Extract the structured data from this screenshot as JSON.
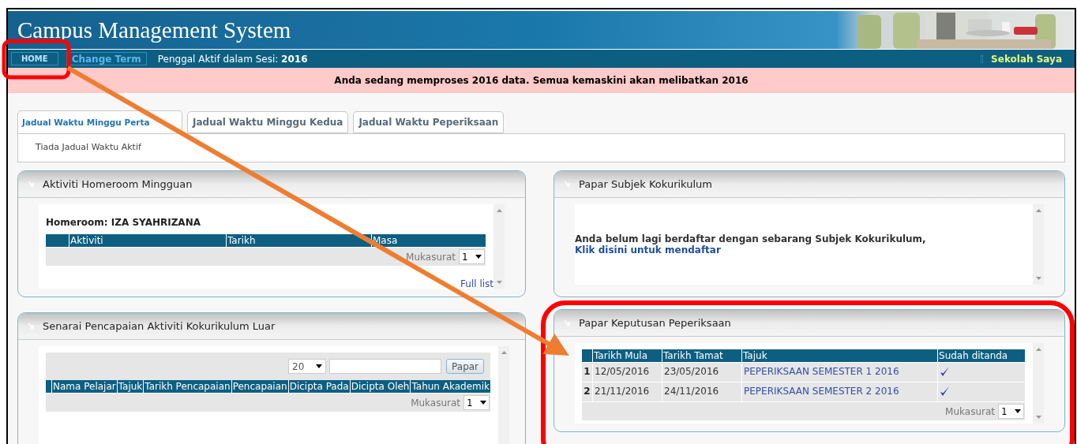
{
  "header": {
    "title": "Campus Management System"
  },
  "nav": {
    "home_button": "HOME",
    "change_term_button": "Change Term",
    "session_label": "Penggal Aktif dalam Sesi:",
    "session_value": "2016",
    "right_link": "Sekolah Saya"
  },
  "notice": "Anda sedang memproses 2016 data. Semua kemaskini akan melibatkan 2016",
  "tabs": [
    {
      "label": "Jadual Waktu Minggu Perta",
      "selected": true
    },
    {
      "label": "Jadual Waktu Minggu Kedua",
      "selected": false
    },
    {
      "label": "Jadual Waktu Peperiksaan",
      "selected": false
    }
  ],
  "tab_content": "Tiada Jadual Waktu Aktif",
  "homeroom_panel": {
    "title": "Aktiviti Homeroom Mingguan",
    "heading": "Homeroom: IZA SYAHRIZANA",
    "columns": [
      "Aktiviti",
      "Tarikh",
      "Masa"
    ],
    "pager_label": "Mukasurat",
    "page": "1",
    "full_list": "Full list"
  },
  "kokurikulum_panel": {
    "title": "Papar Subjek Kokurikulum",
    "message": "Anda belum lagi berdaftar dengan sebarang Subjek Kokurikulum,",
    "link": "Klik disini untuk mendaftar"
  },
  "achievement_panel": {
    "title": "Senarai Pencapaian Aktiviti Kokurikulum Luar",
    "page_size": "20",
    "button": "Papar",
    "columns": [
      "Nama Pelajar",
      "Tajuk",
      "Tarikh Pencapaian",
      "Pencapaian",
      "Dicipta Pada",
      "Dicipta Oleh",
      "Tahun Akademik"
    ],
    "pager_label": "Mukasurat",
    "page": "1"
  },
  "exam_panel": {
    "title": "Papar Keputusan Peperiksaan",
    "columns": [
      "Tarikh Mula",
      "Tarikh Tamat",
      "Tajuk",
      "Sudah ditanda"
    ],
    "rows": [
      {
        "index": "1",
        "start": "12/05/2016",
        "end": "23/05/2016",
        "title": "PEPERIKSAAN SEMESTER 1 2016",
        "marked": true
      },
      {
        "index": "2",
        "start": "21/11/2016",
        "end": "24/11/2016",
        "title": "PEPERIKSAAN SEMESTER 2 2016",
        "marked": true
      }
    ],
    "pager_label": "Mukasurat",
    "page": "1"
  }
}
